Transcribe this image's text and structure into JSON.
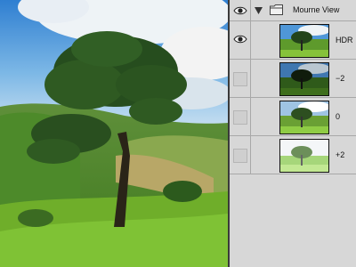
{
  "group": {
    "name": "Mourne View",
    "visible": true,
    "expanded": true
  },
  "layers": [
    {
      "label": "HDR",
      "visible": true
    },
    {
      "label": "−2",
      "visible": false
    },
    {
      "label": "0",
      "visible": false
    },
    {
      "label": "+2",
      "visible": false
    }
  ],
  "icons": {
    "visibility": "eye-icon",
    "disclosure": "triangle-down-icon",
    "group": "folder-icon"
  }
}
